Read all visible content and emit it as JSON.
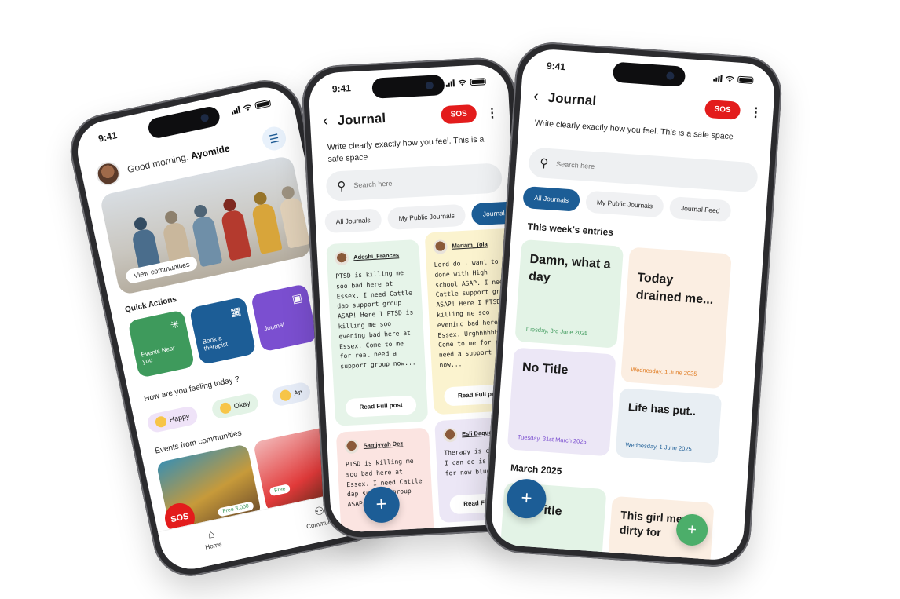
{
  "status_time": "9:41",
  "home": {
    "greeting_prefix": "Good morning, ",
    "greeting_name": "Ayomide",
    "hero_button": "View communities",
    "quick_actions_title": "Quick Actions",
    "quick_actions": [
      {
        "label": "Events Near you",
        "color": "#3e9a5c",
        "icon": "events-icon"
      },
      {
        "label": "Book a therapist",
        "color": "#1c5d96",
        "icon": "calendar-icon"
      },
      {
        "label": "Journal",
        "color": "#7b4fd0",
        "icon": "journal-icon"
      }
    ],
    "mood_title": "How are you feeling today ?",
    "moods": [
      {
        "label": "Happy",
        "color": "#efe3f8"
      },
      {
        "label": "Okay",
        "color": "#e3f3e6"
      },
      {
        "label": "An",
        "color": "#e6ecf7"
      }
    ],
    "events_title": "Events from communities",
    "event_price_1": "Free 3,000",
    "event_price_2": "Free",
    "sos": "SOS",
    "tabs": [
      {
        "label": "Home",
        "icon": "home-icon"
      },
      {
        "label": "Community",
        "icon": "community-icon"
      }
    ]
  },
  "journal_feed": {
    "title": "Journal",
    "sos": "SOS",
    "subtitle": "Write clearly exactly how you feel. This is a safe space",
    "search_placeholder": "Search here",
    "chips": [
      "All Journals",
      "My Public Journals",
      "Journal Feed"
    ],
    "posts": [
      {
        "author": "Adeshi_Frances",
        "text": "PTSD is killing me soo bad here at Essex. I need Cattle dap support group ASAP! Here I PTSD is killing me soo evening bad here at Essex. Come to me for real need a support group now...",
        "bg": "#e6f4e9",
        "button": "Read Full post"
      },
      {
        "author": "Mariam_Tola",
        "text": "Lord do I want to be done with High school ASAP. I need Cattle support group ASAP! Here I PTSD is killing me soo evening bad here at Essex. Urghhhhhh Come to me for real need a support group now...",
        "bg": "#fbf3cf",
        "button": "Read Full post"
      },
      {
        "author": "Samiyyah Dez",
        "text": "PTSD is killing me soo bad here at Essex. I need Cattle dap support group ASAP! Here I",
        "bg": "#fbe4e1",
        "button": ""
      },
      {
        "author": "Esli Daque",
        "text": "Therapy is cool all I can do is for me for now blugss",
        "bg": "#ece7f6",
        "button": "Read Full post"
      }
    ]
  },
  "journal_mine": {
    "title": "Journal",
    "sos": "SOS",
    "subtitle": "Write clearly exactly how you feel. This is a safe space",
    "search_placeholder": "Search here",
    "chips": [
      "All Journals",
      "My Public Journals",
      "Journal Feed"
    ],
    "week_title": "This week's entries",
    "entries": [
      {
        "title": "Damn, what a day",
        "date": "Tuesday, 3rd June 2025",
        "bg": "#e3f3e6",
        "date_color": "#3e9a5c"
      },
      {
        "title": "Today drained me...",
        "date": "Wednesday, 1 June 2025",
        "bg": "#fbeee2",
        "date_color": "#e07a1f"
      },
      {
        "title": "No Title",
        "date": "Tuesday, 31st March 2025",
        "bg": "#ece7f6",
        "date_color": "#7b4fd0"
      },
      {
        "title": "Life has put..",
        "date": "Wednesday, 1 June 2025",
        "bg": "#e8eef3",
        "date_color": "#1c5d96"
      }
    ],
    "month_title": "March 2025",
    "march_entries": [
      {
        "title": "itle",
        "bg": "#e3f3e6"
      },
      {
        "title": "This girl me dirty for",
        "bg": "#fbeee2"
      }
    ]
  },
  "colors": {
    "accent_blue": "#1c5d96",
    "sos_red": "#e31c1c",
    "fab_green": "#4cae6a"
  }
}
